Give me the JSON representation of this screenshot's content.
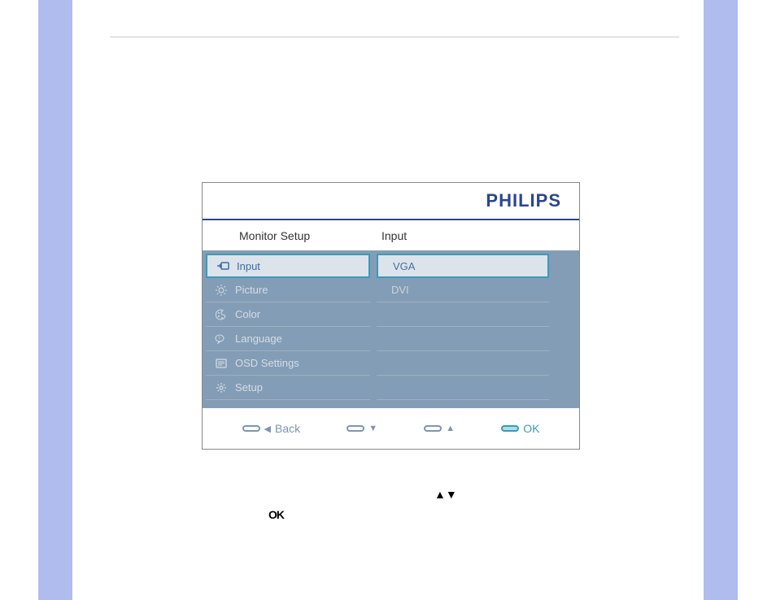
{
  "brand": "PHILIPS",
  "columns": {
    "left_header": "Monitor Setup",
    "right_header": "Input"
  },
  "menu": {
    "items": [
      {
        "label": "Input",
        "icon_name": "input-icon",
        "selected": true
      },
      {
        "label": "Picture",
        "icon_name": "brightness-icon",
        "selected": false
      },
      {
        "label": "Color",
        "icon_name": "color-icon",
        "selected": false
      },
      {
        "label": "Language",
        "icon_name": "language-icon",
        "selected": false
      },
      {
        "label": "OSD Settings",
        "icon_name": "osd-icon",
        "selected": false
      },
      {
        "label": "Setup",
        "icon_name": "gear-icon",
        "selected": false
      }
    ]
  },
  "submenu": {
    "items": [
      {
        "label": "VGA",
        "selected": true
      },
      {
        "label": "DVI",
        "selected": false
      }
    ]
  },
  "footer": {
    "back": "Back",
    "ok": "OK"
  },
  "instructions": {
    "arrows": "▲▼",
    "ok_label": "OK"
  }
}
